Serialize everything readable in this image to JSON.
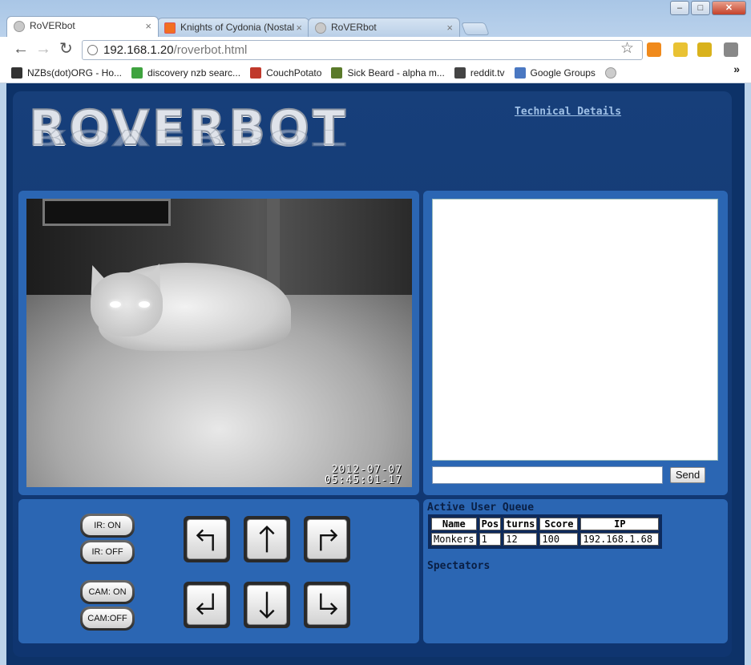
{
  "window": {
    "minimize": "–",
    "maximize": "□",
    "close": "✕"
  },
  "tabs": [
    {
      "title": "RoVERbot",
      "close": "×"
    },
    {
      "title": "Knights of Cydonia (Nostal",
      "close": "×"
    },
    {
      "title": "RoVERbot",
      "close": "×"
    }
  ],
  "toolbar": {
    "back": "←",
    "forward": "→",
    "reload": "↻",
    "url_host": "192.168.1.20",
    "url_path": "/roverbot.html",
    "star": "☆"
  },
  "bookmarks": [
    {
      "label": "NZBs(dot)ORG - Ho...",
      "color": "#333333"
    },
    {
      "label": "discovery nzb searc...",
      "color": "#3fa33f"
    },
    {
      "label": "CouchPotato",
      "color": "#c0392b"
    },
    {
      "label": "Sick Beard - alpha m...",
      "color": "#5a7a2a"
    },
    {
      "label": "reddit.tv",
      "color": "#444444"
    },
    {
      "label": "Google Groups",
      "color": "#4a78c2"
    }
  ],
  "bookmarks_more": "»",
  "header": {
    "logo": "ROVERBOT",
    "tech_link": "Technical Details"
  },
  "camera": {
    "date": "2012-07-07",
    "time": "05:45:01-17"
  },
  "chat": {
    "send_label": "Send",
    "input_value": ""
  },
  "controls": {
    "ir_on": "IR: ON",
    "ir_off": "IR: OFF",
    "cam_on": "CAM: ON",
    "cam_off": "CAM:OFF"
  },
  "queue": {
    "title": "Active User Queue",
    "headers": [
      "Name",
      "Pos",
      "turns",
      "Score",
      "IP"
    ],
    "rows": [
      [
        "Monkers",
        "1",
        "12",
        "100",
        "192.168.1.68"
      ]
    ],
    "spectators_title": "Spectators"
  },
  "colors": {
    "page_bg": "#0d3268",
    "panel": "#2b66b3"
  }
}
